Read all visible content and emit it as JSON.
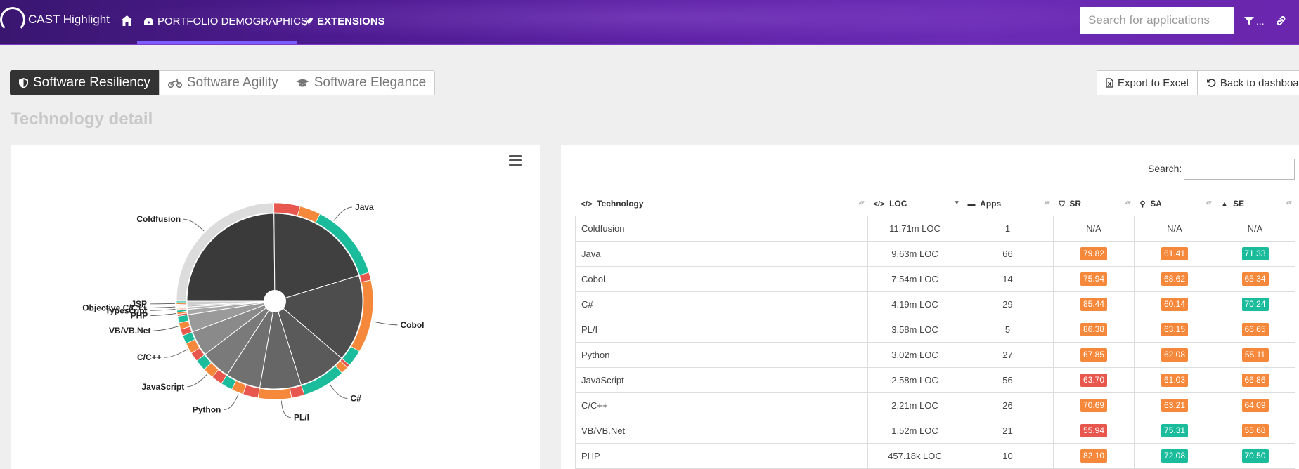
{
  "app": {
    "brand": "CAST Highlight"
  },
  "nav": {
    "home_label": "",
    "portfolio_label": "PORTFOLIO DEMOGRAPHICS",
    "extensions_label": "EXTENSIONS",
    "search_placeholder": "Search for applications",
    "filter_label": "..."
  },
  "tabs": [
    {
      "label": "Software Resiliency",
      "icon": "shield-icon"
    },
    {
      "label": "Software Agility",
      "icon": "motorcycle-icon"
    },
    {
      "label": "Software Elegance",
      "icon": "graduation-cap-icon"
    }
  ],
  "actions": {
    "export": "Export to Excel",
    "back": "Back to dashboard"
  },
  "page": {
    "title": "Technology detail"
  },
  "table": {
    "search_label": "Search:",
    "headers": [
      "Technology",
      "LOC",
      "Apps",
      "SR",
      "SA",
      "SE"
    ],
    "rows": [
      {
        "tech": "Coldfusion",
        "loc": "11.71m LOC",
        "apps": "1",
        "sr": "N/A",
        "sa": "N/A",
        "se": "N/A"
      },
      {
        "tech": "Java",
        "loc": "9.63m LOC",
        "apps": "66",
        "sr": "79.82",
        "sa": "61.41",
        "se": "71.33"
      },
      {
        "tech": "Cobol",
        "loc": "7.54m LOC",
        "apps": "14",
        "sr": "75.94",
        "sa": "68.62",
        "se": "65.34"
      },
      {
        "tech": "C#",
        "loc": "4.19m LOC",
        "apps": "29",
        "sr": "85.44",
        "sa": "60.14",
        "se": "70.24"
      },
      {
        "tech": "PL/I",
        "loc": "3.58m LOC",
        "apps": "5",
        "sr": "86.38",
        "sa": "63.15",
        "se": "66.65"
      },
      {
        "tech": "Python",
        "loc": "3.02m LOC",
        "apps": "27",
        "sr": "67.85",
        "sa": "62.08",
        "se": "55.11"
      },
      {
        "tech": "JavaScript",
        "loc": "2.58m LOC",
        "apps": "56",
        "sr": "63.70",
        "sa": "61.03",
        "se": "66.86"
      },
      {
        "tech": "C/C++",
        "loc": "2.21m LOC",
        "apps": "26",
        "sr": "70.69",
        "sa": "63.21",
        "se": "64.09"
      },
      {
        "tech": "VB/VB.Net",
        "loc": "1.52m LOC",
        "apps": "21",
        "sr": "55.94",
        "sa": "75.31",
        "se": "55.68"
      },
      {
        "tech": "PHP",
        "loc": "457.18k LOC",
        "apps": "10",
        "sr": "82.10",
        "sa": "72.08",
        "se": "70.50"
      }
    ]
  },
  "colors": {
    "good": "#1abc9c",
    "medium": "#f5883a",
    "bad": "#e8574e",
    "na_ring": "#dcdcdc"
  },
  "chart_data": {
    "type": "pie",
    "title": "",
    "categories": [
      "Coldfusion",
      "Java",
      "Cobol",
      "C#",
      "PL/I",
      "Python",
      "JavaScript",
      "C/C++",
      "VB/VB.Net",
      "PHP",
      "Typescript",
      "Objective C/C++",
      "JSP"
    ],
    "values": [
      11.71,
      9.63,
      7.54,
      4.19,
      3.58,
      3.02,
      2.58,
      2.21,
      1.52,
      0.46,
      0.2,
      0.15,
      0.35
    ],
    "value_unit": "m LOC",
    "ring_series": {
      "name": "",
      "description_ratios": [
        [
          0,
          0,
          1
        ],
        [
          0.21,
          0.17,
          0.62
        ],
        [
          0.08,
          0.75,
          0.17
        ],
        [
          0.06,
          0.14,
          0.8
        ],
        [
          0.28,
          0.72,
          0.0
        ],
        [
          0.39,
          0.31,
          0.3
        ],
        [
          0.33,
          0.33,
          0.34
        ],
        [
          0.32,
          0.38,
          0.3
        ],
        [
          0.33,
          0.33,
          0.34
        ],
        [
          0.34,
          0.33,
          0.33
        ],
        [
          0.33,
          0.34,
          0.33
        ],
        [
          0.33,
          0.33,
          0.34
        ],
        [
          0.3,
          0.4,
          0.3
        ]
      ]
    },
    "labels": [
      "Coldfusion",
      "Java",
      "Cobol",
      "C#",
      "PL/I",
      "Python",
      "JavaScript",
      "C/C++",
      "VB/VB.Net",
      "PHP",
      "Typescript",
      "Objective C/C++",
      "JSP"
    ]
  }
}
